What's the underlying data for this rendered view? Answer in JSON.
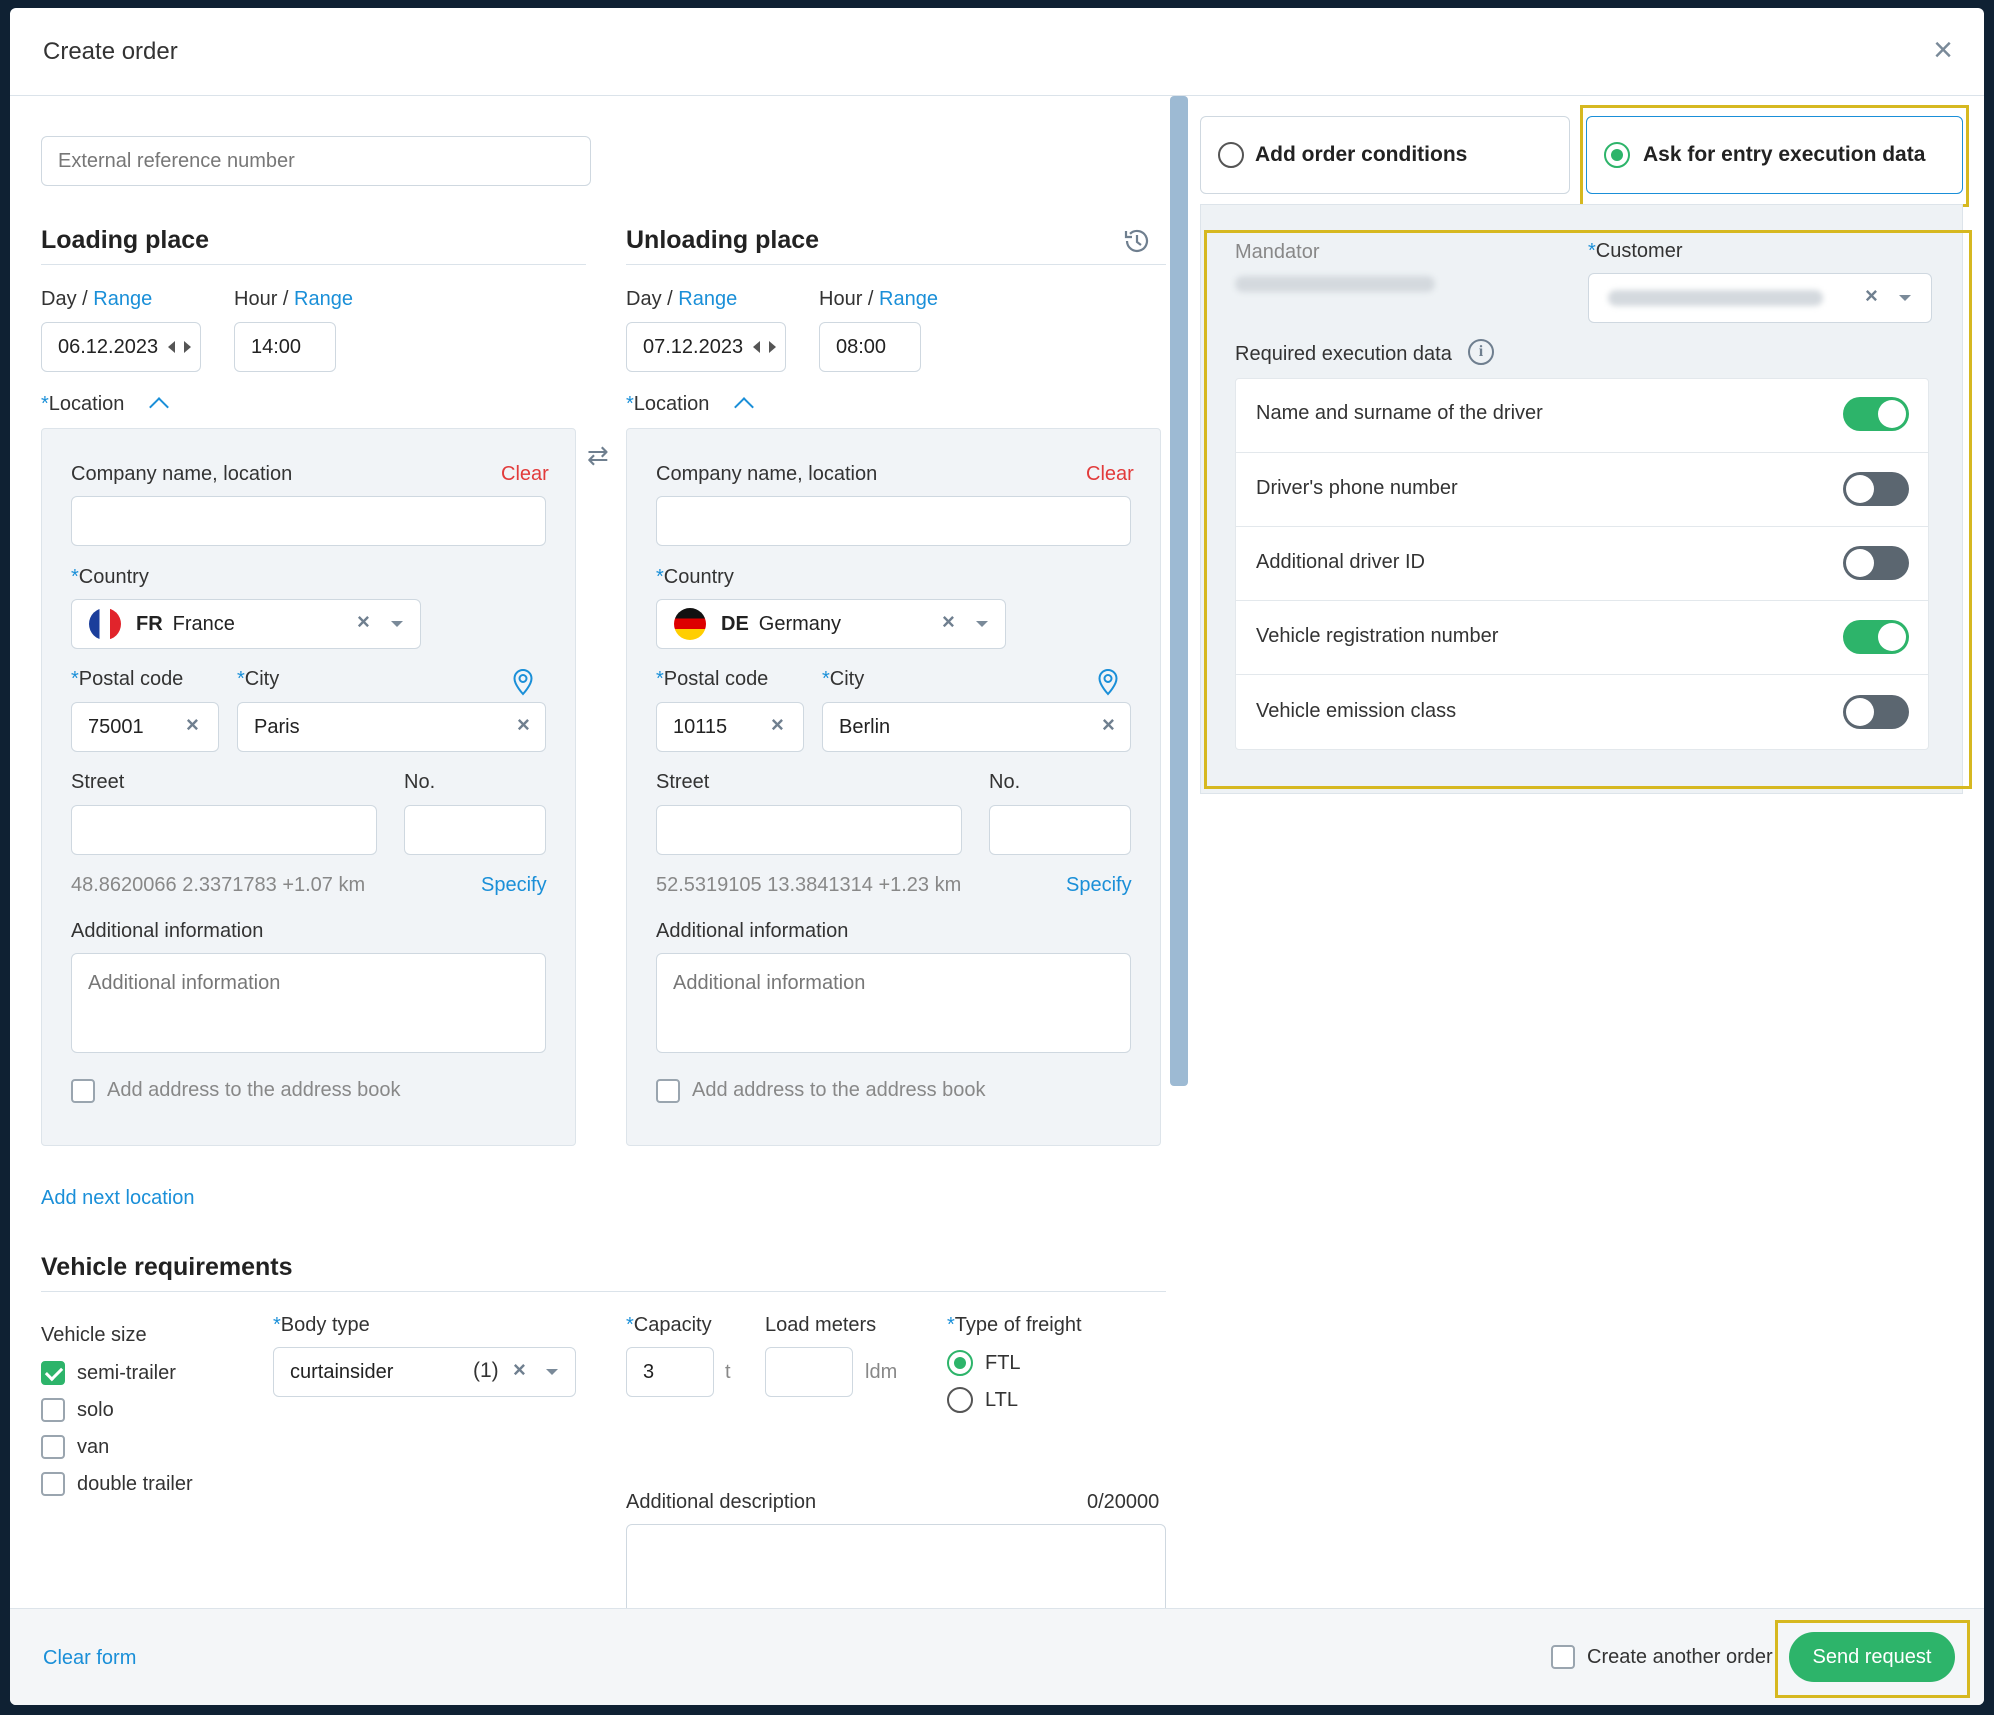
{
  "dialog": {
    "title": "Create order"
  },
  "form": {
    "external_ref_placeholder": "External reference number",
    "loading": {
      "heading": "Loading place",
      "day": "Day",
      "sep": "/",
      "range": "Range",
      "hour": "Hour",
      "day_value": "06.12.2023",
      "hour_value": "14:00",
      "location": "Location",
      "company_label": "Company name, location",
      "clear": "Clear",
      "country_label": "Country",
      "country_code": "FR",
      "country_name": "France",
      "postal_label": "Postal code",
      "postal_value": "75001",
      "city_label": "City",
      "city_value": "Paris",
      "street_label": "Street",
      "no_label": "No.",
      "coords": "48.8620066 2.3371783 +1.07 km",
      "specify": "Specify",
      "additional_label": "Additional information",
      "additional_placeholder": "Additional information",
      "address_book": "Add address to the address book"
    },
    "unloading": {
      "heading": "Unloading place",
      "day": "Day",
      "sep": "/",
      "range": "Range",
      "hour": "Hour",
      "day_value": "07.12.2023",
      "hour_value": "08:00",
      "location": "Location",
      "company_label": "Company name, location",
      "clear": "Clear",
      "country_label": "Country",
      "country_code": "DE",
      "country_name": "Germany",
      "postal_label": "Postal code",
      "postal_value": "10115",
      "city_label": "City",
      "city_value": "Berlin",
      "street_label": "Street",
      "no_label": "No.",
      "coords": "52.5319105 13.3841314 +1.23 km",
      "specify": "Specify",
      "additional_label": "Additional information",
      "additional_placeholder": "Additional information",
      "address_book": "Add address to the address book"
    },
    "add_next_location": "Add next location",
    "vehicle": {
      "heading": "Vehicle requirements",
      "size_label": "Vehicle size",
      "sizes": [
        {
          "label": "semi-trailer",
          "checked": true
        },
        {
          "label": "solo",
          "checked": false
        },
        {
          "label": "van",
          "checked": false
        },
        {
          "label": "double trailer",
          "checked": false
        }
      ],
      "body_type_label": "Body type",
      "body_type_value": "curtainsider",
      "body_type_count": "(1)",
      "capacity_label": "Capacity",
      "capacity_value": "3",
      "capacity_unit": "t",
      "load_meters_label": "Load meters",
      "load_meters_unit": "ldm",
      "freight_label": "Type of freight",
      "freight_options": [
        {
          "label": "FTL",
          "selected": true
        },
        {
          "label": "LTL",
          "selected": false
        }
      ],
      "description_label": "Additional description",
      "description_counter": "0/20000"
    }
  },
  "right": {
    "option_conditions": "Add order conditions",
    "option_execution": "Ask for entry execution data",
    "mandator_label": "Mandator",
    "customer_label": "Customer",
    "required_label": "Required execution data",
    "toggles": [
      {
        "label": "Name and surname of the driver",
        "on": true
      },
      {
        "label": "Driver's phone number",
        "on": false
      },
      {
        "label": "Additional driver ID",
        "on": false
      },
      {
        "label": "Vehicle registration number",
        "on": true
      },
      {
        "label": "Vehicle emission class",
        "on": false
      }
    ]
  },
  "footer": {
    "clear_form": "Clear form",
    "create_another": "Create another order",
    "send": "Send request"
  },
  "colors": {
    "accent": "#1a8fd8",
    "success": "#2db46a",
    "danger": "#e23b3b",
    "highlight": "#d6b820"
  }
}
